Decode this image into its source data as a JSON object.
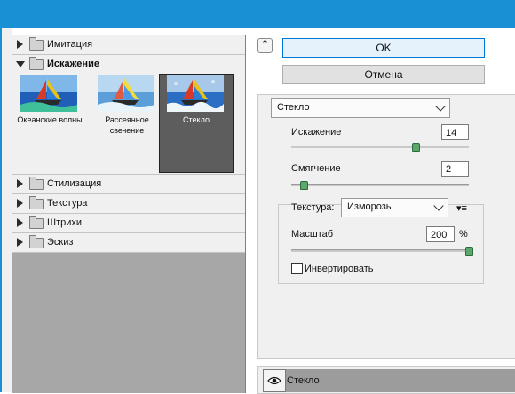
{
  "window": {
    "title_color": "#1a90d4"
  },
  "gallery": {
    "categories": [
      {
        "label": "Имитация",
        "expanded": false
      },
      {
        "label": "Искажение",
        "expanded": true
      },
      {
        "label": "Стилизация",
        "expanded": false
      },
      {
        "label": "Текстура",
        "expanded": false
      },
      {
        "label": "Штрихи",
        "expanded": false
      },
      {
        "label": "Эскиз",
        "expanded": false
      }
    ],
    "filters": [
      {
        "label": "Океанские волны",
        "selected": false
      },
      {
        "label": "Рассеянное свечение",
        "selected": false
      },
      {
        "label": "Стекло",
        "selected": true
      }
    ]
  },
  "buttons": {
    "ok": "OK",
    "cancel": "Отмена",
    "collapse_icon": "collapse-up-icon"
  },
  "filter_select": {
    "value": "Стекло"
  },
  "params": {
    "distortion": {
      "label": "Искажение",
      "value": "14",
      "min": 0,
      "max": 20,
      "level": 14
    },
    "smoothness": {
      "label": "Смягчение",
      "value": "2",
      "min": 1,
      "max": 15,
      "level": 2
    },
    "texture": {
      "label": "Текстура:",
      "value": "Изморозь"
    },
    "scale": {
      "label": "Масштаб",
      "value": "200",
      "unit": "%",
      "min": 50,
      "max": 200,
      "level": 200
    },
    "invert": {
      "label": "Инвертировать",
      "checked": false
    }
  },
  "layers": {
    "items": [
      {
        "label": "Стекло",
        "visible": true
      }
    ]
  }
}
